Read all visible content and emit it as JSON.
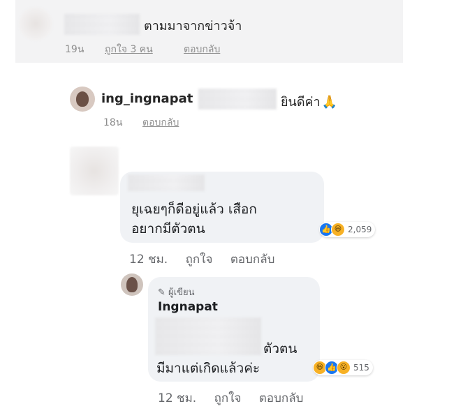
{
  "ig_comment_1": {
    "text": "ตามมาจากข่าวจ้า",
    "time": "19น",
    "likes": "ถูกใจ 3 คน",
    "reply": "ตอบกลับ"
  },
  "ig_reply": {
    "username": "ing_ingnapat",
    "text": "ยินดีค่า",
    "emoji": "🙏",
    "time": "18น",
    "reply": "ตอบกลับ"
  },
  "fb_comment": {
    "line1": "ยุเฉยๆก็ดีอยู่แล้ว เสือก",
    "line2": "อยากมีตัวตน",
    "reaction_icons": [
      "like-icon",
      "haha-icon"
    ],
    "reaction_count": "2,059",
    "time": "12 ชม.",
    "like": "ถูกใจ",
    "reply": "ตอบกลับ"
  },
  "fb_author_reply": {
    "author_tag": "ผู้เขียน",
    "name": "Ingnapat",
    "line1_visible": "ตัวตน",
    "line2": "มีมาแต่เกิดแล้วค่ะ",
    "reaction_icons": [
      "haha-icon",
      "like-icon",
      "wow-icon"
    ],
    "reaction_count": "515",
    "time": "12 ชม.",
    "like": "ถูกใจ",
    "reply": "ตอบกลับ"
  }
}
